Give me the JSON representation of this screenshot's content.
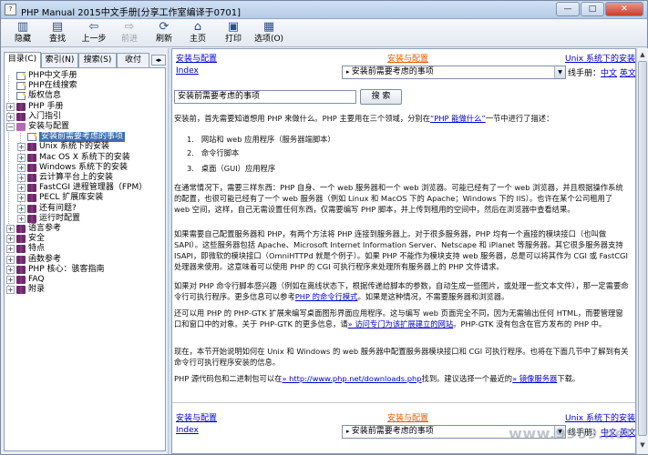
{
  "window": {
    "title": "PHP Manual 2015中文手册[分享工作室编译于0701]",
    "controls": {
      "minimize": "—",
      "maximize": "□",
      "close": "✕"
    }
  },
  "toolbar": {
    "hide": "隐藏",
    "find": "查找",
    "back": "上一步",
    "forward": "前进",
    "refresh": "刷新",
    "home": "主页",
    "print": "打印",
    "options": "选项(O)"
  },
  "tabs": {
    "contents": "目录(C)",
    "index": "索引(N)",
    "search": "搜索(S)",
    "favorites": "收付"
  },
  "tree": [
    {
      "label": "PHP中文手册",
      "icon": "page",
      "level": 0,
      "exp": ""
    },
    {
      "label": "PHP在线搜索",
      "icon": "page",
      "level": 0,
      "exp": ""
    },
    {
      "label": "版权信息",
      "icon": "page",
      "level": 0,
      "exp": ""
    },
    {
      "label": "PHP 手册",
      "icon": "book",
      "level": 0,
      "exp": "+"
    },
    {
      "label": "入门指引",
      "icon": "book",
      "level": 0,
      "exp": "+"
    },
    {
      "label": "安装与配置",
      "icon": "open",
      "level": 0,
      "exp": "−"
    },
    {
      "label": "安装前需要考虑的事项",
      "icon": "page",
      "level": 1,
      "exp": "",
      "selected": true
    },
    {
      "label": "Unix 系统下的安装",
      "icon": "book",
      "level": 1,
      "exp": "+"
    },
    {
      "label": "Mac OS X 系统下的安装",
      "icon": "book",
      "level": 1,
      "exp": "+"
    },
    {
      "label": "Windows 系统下的安装",
      "icon": "book",
      "level": 1,
      "exp": "+"
    },
    {
      "label": "云计算平台上的安装",
      "icon": "book",
      "level": 1,
      "exp": "+"
    },
    {
      "label": "FastCGI 进程管理器（FPM）",
      "icon": "book",
      "level": 1,
      "exp": "+"
    },
    {
      "label": "PECL 扩展库安装",
      "icon": "book",
      "level": 1,
      "exp": "+"
    },
    {
      "label": "还有问题?",
      "icon": "book",
      "level": 1,
      "exp": "+"
    },
    {
      "label": "运行时配置",
      "icon": "book",
      "level": 1,
      "exp": "+"
    },
    {
      "label": "语言参考",
      "icon": "book",
      "level": 0,
      "exp": "+"
    },
    {
      "label": "安全",
      "icon": "book",
      "level": 0,
      "exp": "+"
    },
    {
      "label": "特点",
      "icon": "book",
      "level": 0,
      "exp": "+"
    },
    {
      "label": "函数参考",
      "icon": "book",
      "level": 0,
      "exp": "+"
    },
    {
      "label": "PHP 核心：骇客指南",
      "icon": "book",
      "level": 0,
      "exp": "+"
    },
    {
      "label": "FAQ",
      "icon": "book",
      "level": 0,
      "exp": "+"
    },
    {
      "label": "附录",
      "icon": "book",
      "level": 0,
      "exp": "+"
    }
  ],
  "nav": {
    "up_link": "安装与配置",
    "prev_link": "安装与配置",
    "next_link": "Unix 系统下的安装",
    "index_link": "Index",
    "select_value": "安装前需要考虑的事项",
    "lang_label": "线手册：",
    "lang_zh": "中文",
    "lang_en": "英文"
  },
  "search": {
    "value": "安装前需要考虑的事项",
    "button": "搜 索"
  },
  "body": {
    "intro_a": "安装前，首先需要知道想用 PHP 来做什么。PHP 主要用在三个领域，分别在",
    "intro_link": "“PHP 能做什么”",
    "intro_b": "一节中进行了描述：",
    "list": [
      "网站和 web 应用程序（服务器端脚本）",
      "命令行脚本",
      "桌面（GUI）应用程序"
    ],
    "p1": "在通常情况下，需要三样东西：PHP 自身、一个 web 服务器和一个 web 浏览器。可能已经有了一个 web 浏览器，并且根据操作系统的配置，也很可能已经有了一个 web 服务器（例如 Linux 和 MacOS 下的 Apache；Windows 下的 IIS）。也许在某个公司租用了 web 空间，这样，自己无需设置任何东西，仅需要编写 PHP 脚本，并上传到租用的空间中，然后在浏览器中查看结果。",
    "p2": "如果需要自己配置服务器和 PHP，有两个方法将 PHP 连接到服务器上。对于很多服务器，PHP 均有一个直接的模块接口（也叫做 SAPI）。这些服务器包括 Apache、Microsoft Internet Information Server、Netscape 和 iPlanet 等服务器。其它很多服务器支持 ISAPI，即微软的模块接口（OmniHTTPd 就是个例子）。如果 PHP 不能作为模块支持 web 服务器，总是可以将其作为 CGI 或 FastCGI 处理器来使用。这意味着可以使用 PHP 的 CGI 可执行程序来处理所有服务器上的 PHP 文件请求。",
    "p3_a": "如果对 PHP 命令行脚本感兴趣（例如在离线状态下，根据传递给脚本的参数，自动生成一些图片，或处理一些文本文件），那一定需要命令行可执行程序。更多信息可以参考",
    "p3_link": "PHP 的命令行模式",
    "p3_b": "。如果是这种情况，不需要服务器和浏览器。",
    "p4_a": "还可以用 PHP 的 PHP-GTK 扩展来编写桌面图形界面应用程序。这与编写 web 页面完全不同，因为无需输出任何 HTML，而要管理窗口和窗口中的对象。关于 PHP-GTK 的更多信息，请",
    "p4_link": "» 访问专门为该扩展建立的网站",
    "p4_b": "。PHP-GTK 没有包含在官方发布的 PHP 中。",
    "p5": "现在，本节开始说明如何在 Unix 和 Windows 的 web 服务器中配置服务器模块接口和 CGI 可执行程序。也将在下面几节中了解到有关命令行可执行程序安装的信息。",
    "p6_a": "PHP 源代码包和二进制包可以在",
    "p6_link1": "» http://www.php.net/downloads.php",
    "p6_b": "找到。建议选择一个最近的",
    "p6_link2": "» 镜像服务器",
    "p6_c": "下载。"
  },
  "watermark": "www.9969.net"
}
